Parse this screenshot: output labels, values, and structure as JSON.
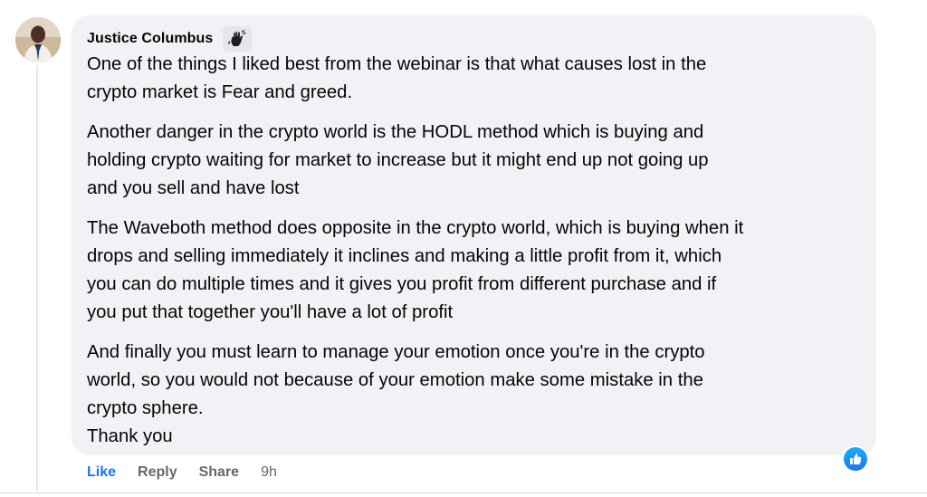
{
  "comment": {
    "author": "Justice Columbus",
    "badge_icon": "wave-hand-icon",
    "paragraphs": [
      "One of the things I liked best from the webinar is that what causes lost in the\ncrypto market is Fear and greed.",
      "Another danger in the crypto world is the HODL method which is buying and\nholding crypto waiting for market to increase but it might end up not going up\nand you sell and have lost",
      "The Waveboth method does opposite in the crypto world, which is buying when it\ndrops and selling immediately it inclines and making a little profit from it, which\nyou can do multiple times and it gives you profit from different purchase and if\nyou put that together you'll have a lot of profit",
      "And finally you must learn to manage your emotion once you're in the crypto\nworld, so you would not because of your emotion make some mistake in the\ncrypto sphere.\nThank you"
    ]
  },
  "actions": {
    "like": "Like",
    "reply": "Reply",
    "share": "Share",
    "time": "9h"
  },
  "reaction": {
    "icon": "like-thumbs-up-icon",
    "color": "#1877f2"
  },
  "colors": {
    "bubble": "#f0f2f5",
    "text": "#050505",
    "secondary": "#65676b",
    "accent": "#1877f2"
  }
}
